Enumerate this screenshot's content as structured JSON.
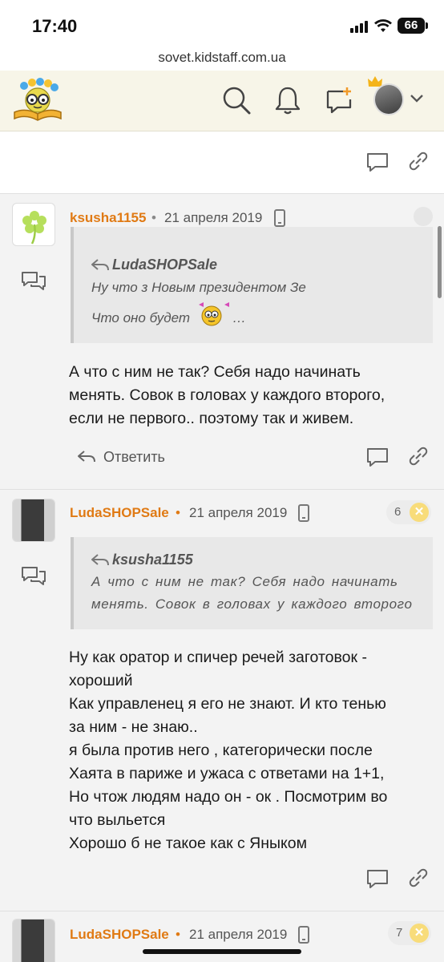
{
  "status": {
    "time": "17:40",
    "battery": "66"
  },
  "browser": {
    "url": "sovet.kidstaff.com.ua"
  },
  "header": {
    "icons": [
      "search-icon",
      "bell-icon",
      "new-message-icon",
      "avatar",
      "chevron-down-icon"
    ]
  },
  "posts": [
    {
      "author": "ksusha1155",
      "date": "21 апреля 2019",
      "quote": {
        "author": "LudaSHOPSale",
        "line1": "Ну что з Новым президентом Зе",
        "line2": "Что оно будет",
        "ellipsis": "…"
      },
      "text": [
        "А что с ним не так? Себя надо начинать",
        "менять. Совок в головах у каждого второго,",
        "если не первого.. поэтому так и живем."
      ],
      "reply_label": "Ответить"
    },
    {
      "author": "LudaSHOPSale",
      "date": "21 апреля 2019",
      "badge": "6",
      "quote": {
        "author": "ksusha1155",
        "line1": "А что с ним не так? Себя надо начинать",
        "line2": "менять. Совок в головах у каждого второго"
      },
      "text": [
        "Ну как оратор и спичер речей заготовок -",
        "хороший",
        "Как управленец я его не знают. И кто тенью",
        "за ним - не знаю..",
        "я была против него , категорически после",
        "Хаята в париже и ужаса с ответами на 1+1,",
        "Но чтож людям надо он - ок . Посмотрим во",
        "что выльется",
        "Хорошо б не такое как с Яныком"
      ]
    },
    {
      "author": "LudaSHOPSale",
      "date": "21 апреля 2019",
      "badge": "7"
    }
  ]
}
